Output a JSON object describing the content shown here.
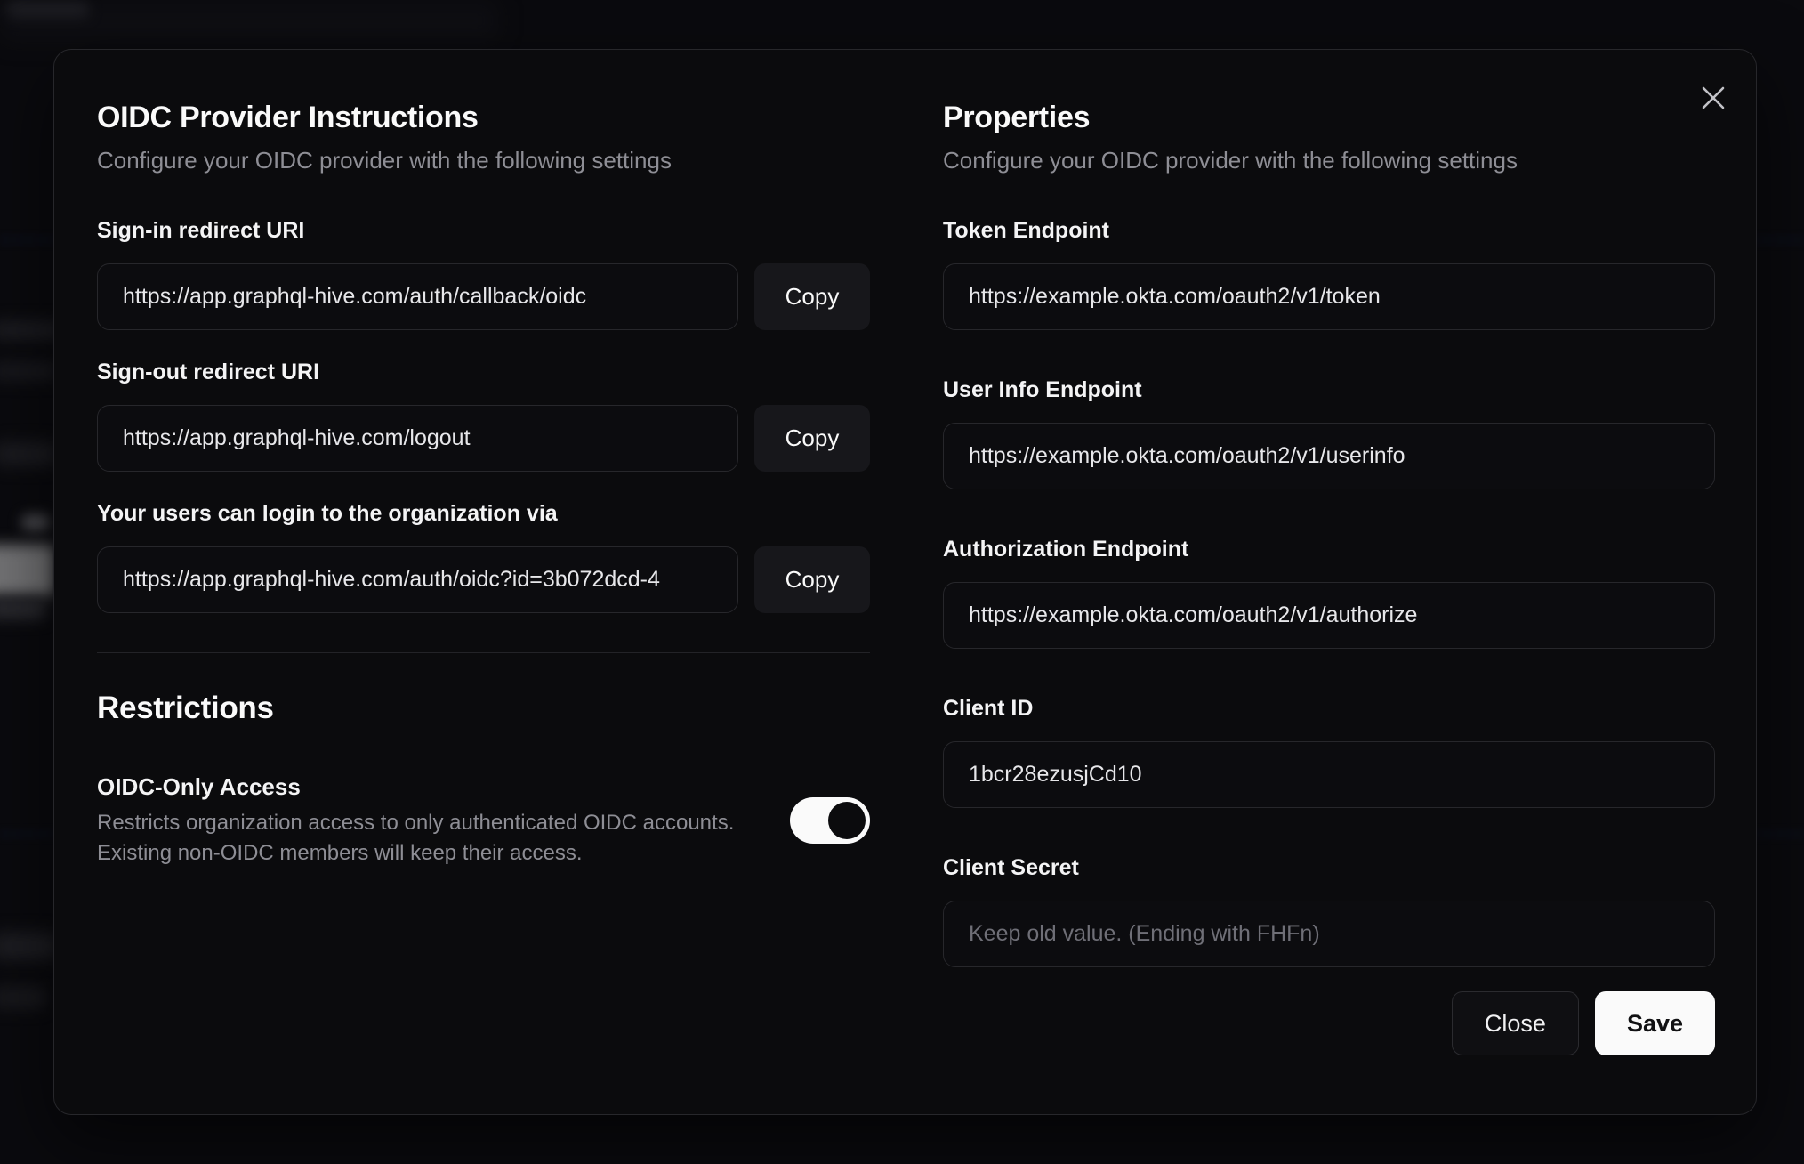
{
  "colors": {
    "modal_background": "#0b0b0d",
    "border": "#27272b",
    "primary_text": "#fafafa",
    "muted_text": "#8e8e95",
    "toggle_on_track": "#fafafa",
    "save_button_bg": "#fafafa"
  },
  "modal": {
    "left": {
      "title": "OIDC Provider Instructions",
      "subtitle": "Configure your OIDC provider with the following settings",
      "fields": [
        {
          "label": "Sign-in redirect URI",
          "value": "https://app.graphql-hive.com/auth/callback/oidc",
          "button": "Copy"
        },
        {
          "label": "Sign-out redirect URI",
          "value": "https://app.graphql-hive.com/logout",
          "button": "Copy"
        },
        {
          "label": "Your users can login to the organization via",
          "value": "https://app.graphql-hive.com/auth/oidc?id=3b072dcd-4",
          "button": "Copy"
        }
      ],
      "restrictions": {
        "title": "Restrictions",
        "toggle_label": "OIDC-Only Access",
        "toggle_description_line1": "Restricts organization access to only authenticated OIDC accounts.",
        "toggle_description_line2": "Existing non-OIDC members will keep their access.",
        "toggle_state": "on"
      }
    },
    "right": {
      "title": "Properties",
      "subtitle": "Configure your OIDC provider with the following settings",
      "fields": [
        {
          "label": "Token Endpoint",
          "value": "https://example.okta.com/oauth2/v1/token"
        },
        {
          "label": "User Info Endpoint",
          "value": "https://example.okta.com/oauth2/v1/userinfo"
        },
        {
          "label": "Authorization Endpoint",
          "value": "https://example.okta.com/oauth2/v1/authorize"
        },
        {
          "label": "Client ID",
          "value": "1bcr28ezusjCd10"
        },
        {
          "label": "Client Secret",
          "value": "",
          "placeholder": "Keep old value. (Ending with FHFn)"
        }
      ],
      "buttons": {
        "close": "Close",
        "save": "Save"
      }
    }
  }
}
